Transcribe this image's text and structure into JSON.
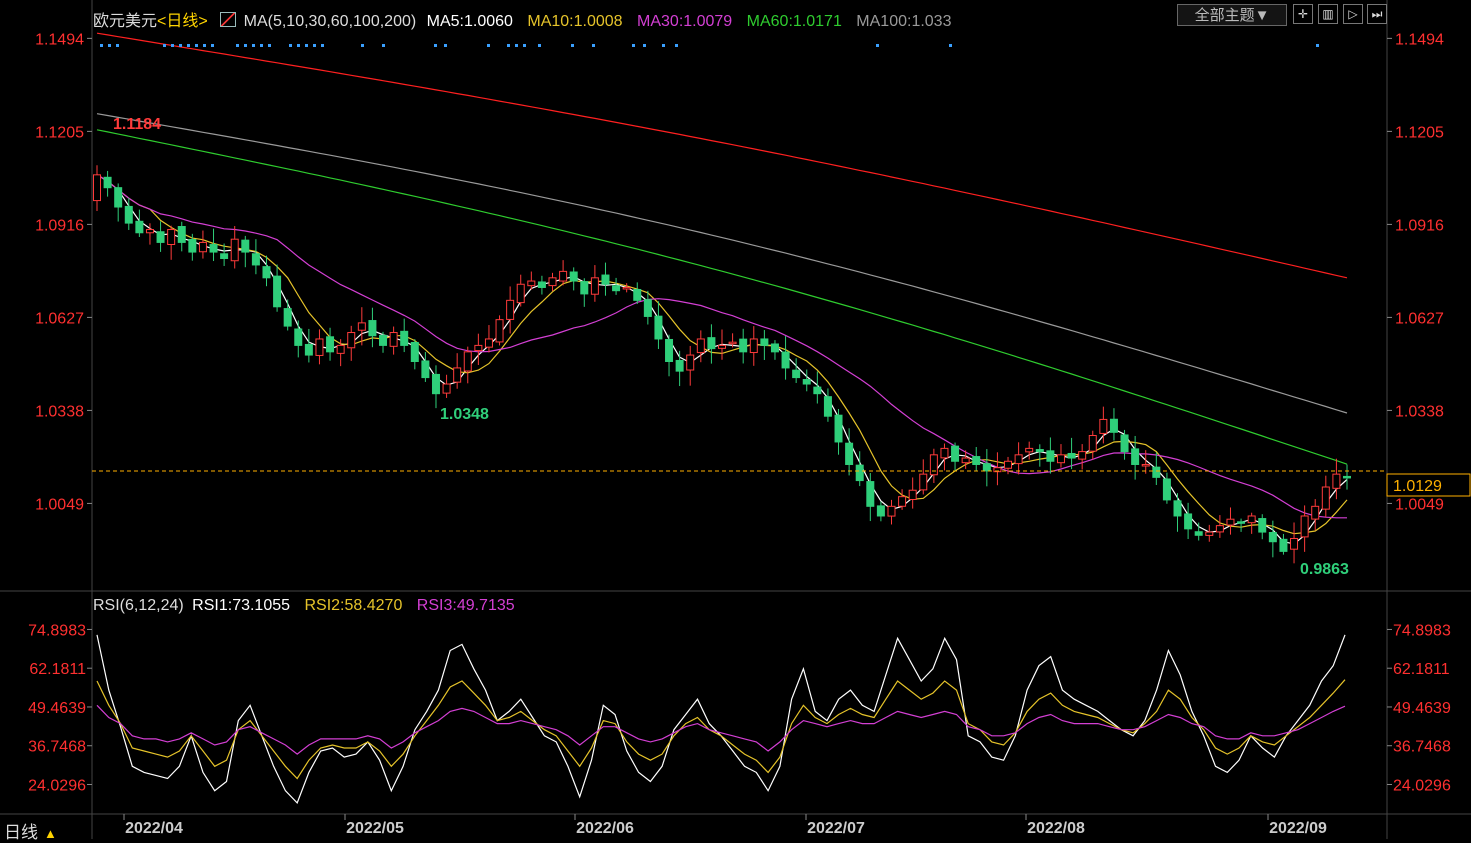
{
  "header": {
    "symbol": "欧元美元",
    "period_tag": "<日线>",
    "indicator_label": "MA(5,10,30,60,100,200)",
    "ma5": "MA5:1.0060",
    "ma10": "MA10:1.0008",
    "ma30": "MA30:1.0079",
    "ma60": "MA60:1.0171",
    "ma100": "MA100:1.033",
    "theme_button": "全部主题▼"
  },
  "rsi_header": {
    "label": "RSI(6,12,24)",
    "rsi1": "RSI1:73.1055",
    "rsi2": "RSI2:58.4270",
    "rsi3": "RSI3:49.7135"
  },
  "period_selector": {
    "label": "日线",
    "arrow": "▲"
  },
  "colors": {
    "up": "#ff3b3b",
    "down": "#2fcf7a",
    "ma5": "#ffffff",
    "ma10": "#e5c32a",
    "ma30": "#d33fd3",
    "ma60": "#2fcc2f",
    "ma100": "#9a9a9a",
    "ma200": "#ff2020",
    "price_axis": "#ff3030",
    "last_price": "#ffb000"
  },
  "chart_data": [
    {
      "type": "candlestick",
      "title": "欧元美元 日线",
      "y_ticks": [
        "1.1494",
        "1.1205",
        "1.0916",
        "1.0627",
        "1.0338",
        "1.0049"
      ],
      "ylim": [
        0.978,
        1.152
      ],
      "x_ticks": [
        "2022/04",
        "2022/05",
        "2022/06",
        "2022/07",
        "2022/08",
        "2022/09"
      ],
      "last_price": "1.0129",
      "annotations": {
        "high": "1.1184",
        "mid_low": "1.0348",
        "low": "0.9863"
      },
      "series_ma": [
        "MA5",
        "MA10",
        "MA30",
        "MA60",
        "MA100",
        "MA200"
      ],
      "close_path": [
        1.107,
        1.103,
        1.097,
        1.092,
        1.089,
        1.09,
        1.086,
        1.09,
        1.086,
        1.083,
        1.086,
        1.083,
        1.081,
        1.087,
        1.083,
        1.079,
        1.075,
        1.066,
        1.06,
        1.054,
        1.051,
        1.056,
        1.052,
        1.054,
        1.058,
        1.061,
        1.057,
        1.054,
        1.058,
        1.054,
        1.049,
        1.044,
        1.039,
        1.042,
        1.047,
        1.052,
        1.054,
        1.056,
        1.062,
        1.068,
        1.073,
        1.074,
        1.072,
        1.075,
        1.077,
        1.074,
        1.07,
        1.075,
        1.073,
        1.071,
        1.072,
        1.068,
        1.063,
        1.056,
        1.049,
        1.046,
        1.051,
        1.056,
        1.053,
        1.054,
        1.055,
        1.052,
        1.056,
        1.054,
        1.052,
        1.047,
        1.044,
        1.042,
        1.039,
        1.032,
        1.024,
        1.017,
        1.012,
        1.004,
        1.001,
        1.004,
        1.007,
        1.009,
        1.014,
        1.02,
        1.022,
        1.018,
        1.019,
        1.017,
        1.015,
        1.016,
        1.018,
        1.02,
        1.022,
        1.021,
        1.018,
        1.02,
        1.019,
        1.021,
        1.026,
        1.031,
        1.027,
        1.021,
        1.017,
        1.017,
        1.013,
        1.006,
        1.001,
        0.997,
        0.995,
        0.996,
        0.998,
        1.0,
        0.999,
        1.001,
        0.996,
        0.993,
        0.99,
        0.994,
        1.001,
        1.004,
        1.01,
        1.014,
        1.013
      ],
      "dates": [
        "2022-03-28",
        "2022-09-13"
      ]
    },
    {
      "type": "line",
      "title": "RSI(6,12,24)",
      "y_ticks": [
        "74.8983",
        "62.1811",
        "49.4639",
        "36.7468",
        "24.0296"
      ],
      "ylim": [
        15,
        78
      ],
      "series": [
        {
          "name": "RSI1",
          "values": [
            73.1,
            55,
            43,
            30,
            28,
            27,
            26,
            30,
            40,
            28,
            22,
            25,
            45,
            50,
            40,
            30,
            22,
            18,
            28,
            35,
            36,
            33,
            34,
            38,
            32,
            22,
            30,
            42,
            48,
            55,
            68,
            70,
            62,
            55,
            45,
            48,
            52,
            46,
            40,
            38,
            30,
            20,
            32,
            50,
            47,
            35,
            28,
            25,
            30,
            42,
            47,
            52,
            44,
            40,
            35,
            30,
            28,
            22,
            30,
            52,
            62,
            48,
            45,
            52,
            55,
            50,
            48,
            60,
            72,
            65,
            58,
            62,
            72,
            65,
            40,
            38,
            33,
            32,
            40,
            55,
            63,
            66,
            55,
            52,
            50,
            48,
            45,
            42,
            40,
            45,
            55,
            68,
            60,
            48,
            40,
            30,
            28,
            32,
            40,
            36,
            33,
            40,
            45,
            50,
            58,
            63,
            73.1
          ]
        },
        {
          "name": "RSI2",
          "values": [
            58,
            50,
            44,
            36,
            35,
            34,
            33,
            35,
            40,
            35,
            30,
            32,
            42,
            45,
            40,
            35,
            30,
            26,
            32,
            36,
            37,
            36,
            36,
            38,
            35,
            30,
            34,
            40,
            45,
            50,
            56,
            58,
            54,
            50,
            45,
            46,
            48,
            45,
            42,
            40,
            35,
            30,
            36,
            45,
            44,
            38,
            34,
            32,
            34,
            40,
            44,
            46,
            42,
            40,
            37,
            34,
            32,
            28,
            33,
            44,
            50,
            46,
            44,
            47,
            49,
            47,
            46,
            52,
            58,
            55,
            52,
            54,
            58,
            55,
            44,
            42,
            38,
            37,
            41,
            48,
            52,
            54,
            50,
            48,
            47,
            46,
            44,
            42,
            41,
            44,
            48,
            55,
            52,
            46,
            42,
            36,
            34,
            36,
            40,
            38,
            37,
            40,
            43,
            46,
            50,
            54,
            58.4
          ]
        },
        {
          "name": "RSI3",
          "values": [
            50,
            46,
            44,
            40,
            39,
            39,
            38,
            39,
            41,
            39,
            37,
            38,
            42,
            43,
            41,
            39,
            37,
            34,
            37,
            39,
            39,
            39,
            39,
            40,
            39,
            36,
            38,
            41,
            43,
            45,
            48,
            49,
            48,
            46,
            44,
            44,
            45,
            44,
            43,
            42,
            40,
            37,
            40,
            43,
            43,
            41,
            39,
            38,
            39,
            41,
            43,
            44,
            42,
            41,
            40,
            39,
            38,
            35,
            38,
            42,
            45,
            44,
            43,
            44,
            45,
            44,
            44,
            46,
            48,
            47,
            46,
            47,
            48,
            47,
            43,
            42,
            40,
            40,
            41,
            44,
            46,
            47,
            45,
            44,
            44,
            44,
            43,
            42,
            42,
            43,
            45,
            47,
            46,
            44,
            43,
            40,
            39,
            39,
            41,
            40,
            40,
            41,
            42,
            44,
            46,
            48,
            49.7
          ]
        }
      ]
    }
  ]
}
